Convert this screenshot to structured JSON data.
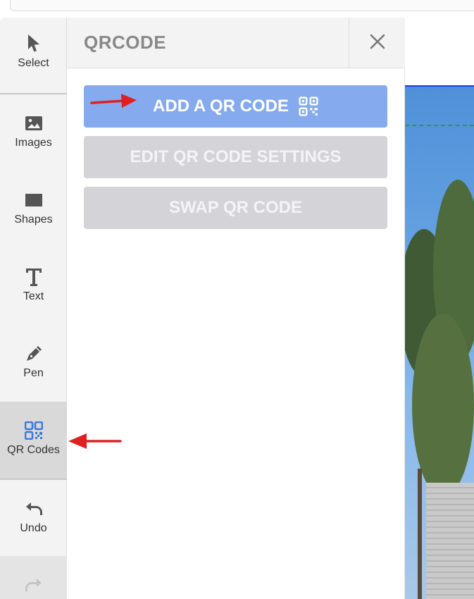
{
  "rail": {
    "items": [
      {
        "label": "Select",
        "icon": "cursor-icon"
      },
      {
        "label": "Images",
        "icon": "image-icon"
      },
      {
        "label": "Shapes",
        "icon": "rectangle-icon"
      },
      {
        "label": "Text",
        "icon": "text-icon"
      },
      {
        "label": "Pen",
        "icon": "pen-icon"
      },
      {
        "label": "QR Codes",
        "icon": "qr-code-icon"
      },
      {
        "label": "Undo",
        "icon": "undo-icon"
      }
    ],
    "active": "QR Codes"
  },
  "panel": {
    "title": "QRCODE",
    "add_label": "ADD A QR CODE",
    "edit_label": "EDIT QR CODE SETTINGS",
    "swap_label": "SWAP QR CODE"
  },
  "colors": {
    "accent": "#85aaee",
    "disabled": "#d4d4d8",
    "qr_active": "#3a78e0",
    "annotation_arrow": "#e02020"
  }
}
